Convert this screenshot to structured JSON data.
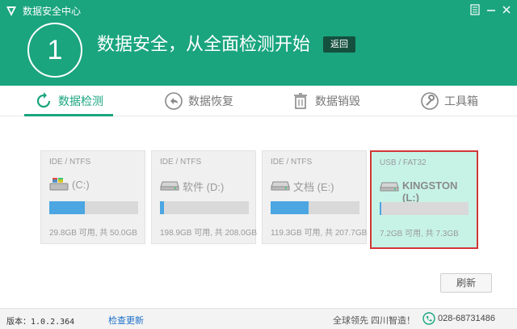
{
  "app": {
    "title": "数据安全中心",
    "brand_color": "#1aa57f"
  },
  "window": {
    "menu_icon": "menu-icon",
    "min_icon": "minimize-icon",
    "close_icon": "close-icon"
  },
  "hero": {
    "step": "1",
    "title": "数据安全，从全面检测开始",
    "back_label": "返回"
  },
  "tabs": [
    {
      "label": "数据检测",
      "icon": "refresh-scan-icon",
      "active": true
    },
    {
      "label": "数据恢复",
      "icon": "undo-arrow-icon",
      "active": false
    },
    {
      "label": "数据销毁",
      "icon": "trash-icon",
      "active": false
    },
    {
      "label": "工具箱",
      "icon": "wrench-icon",
      "active": false
    }
  ],
  "drives": [
    {
      "type": "IDE / NTFS",
      "name": "(C:)",
      "usage": 0.404,
      "capacity": "29.8GB 可用, 共 50.0GB",
      "icon": "windows-drive-icon"
    },
    {
      "type": "IDE / NTFS",
      "name": "软件 (D:)",
      "usage": 0.044,
      "capacity": "198.9GB 可用, 共 208.0GB",
      "icon": "hard-disk-icon"
    },
    {
      "type": "IDE / NTFS",
      "name": "文档 (E:)",
      "usage": 0.425,
      "capacity": "119.3GB 可用, 共 207.7GB",
      "icon": "hard-disk-icon"
    },
    {
      "type": "USB / FAT32",
      "name": "KINGSTON (L:)",
      "usage": 0.014,
      "capacity": "7.2GB 可用, 共 7.3GB",
      "icon": "usb-drive-icon",
      "selected": true
    }
  ],
  "actions": {
    "refresh_label": "刷新"
  },
  "status": {
    "version": "版本：1.0.2.364",
    "check_update": "检查更新",
    "slogan": "全球领先 四川智造！",
    "phone": "028-68731486"
  }
}
